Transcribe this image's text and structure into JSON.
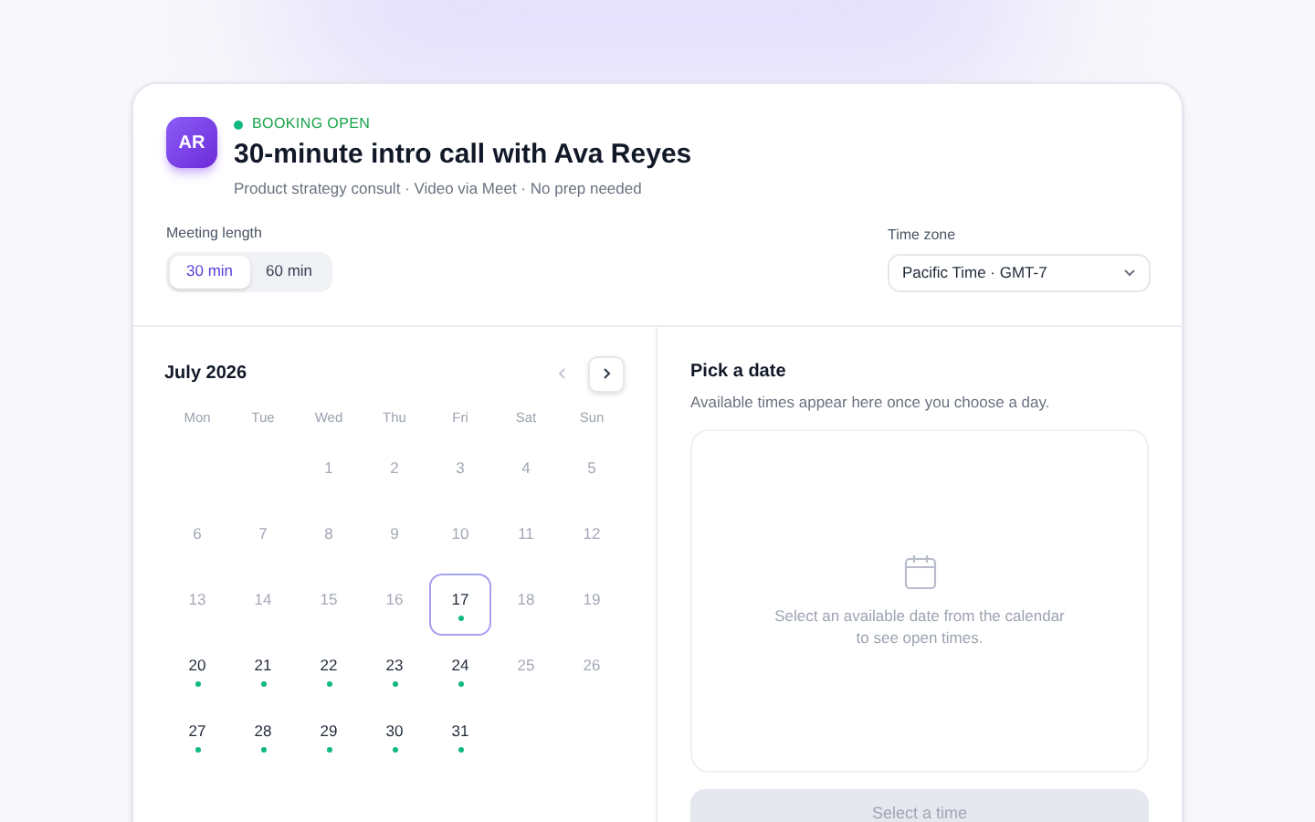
{
  "booking": {
    "status": "BOOKING OPEN",
    "open": true,
    "avatar": "AR",
    "title": "30-minute intro call with Ava Reyes",
    "subtitle": "Product strategy consult · Video via Meet · No prep needed"
  },
  "meeting_length": {
    "label": "Meeting length",
    "options": [
      {
        "label": "30 min",
        "selected": true
      },
      {
        "label": "60 min",
        "selected": false
      }
    ]
  },
  "time_zone": {
    "label": "Time zone",
    "value": "Pacific Time · GMT-7"
  },
  "calendar": {
    "month": "July 2026",
    "prev_disabled": true,
    "next_disabled": false,
    "weekdays": [
      "Mon",
      "Tue",
      "Wed",
      "Thu",
      "Fri",
      "Sat",
      "Sun"
    ],
    "weeks": [
      {
        "kind": "leading",
        "days": [
          {
            "day": "1",
            "available": false,
            "selected": false
          },
          {
            "day": "2",
            "available": false,
            "selected": false
          },
          {
            "day": "3",
            "available": false,
            "selected": false
          },
          {
            "day": "4",
            "available": false,
            "selected": false
          },
          {
            "day": "5",
            "available": false,
            "selected": false
          }
        ]
      },
      {
        "kind": "trailing",
        "days": [
          {
            "day": "6",
            "available": false,
            "selected": false
          },
          {
            "day": "7",
            "available": false,
            "selected": false
          },
          {
            "day": "8",
            "available": false,
            "selected": false
          },
          {
            "day": "9",
            "available": false,
            "selected": false
          },
          {
            "day": "10",
            "available": false,
            "selected": false
          },
          {
            "day": "11",
            "available": false,
            "selected": false
          },
          {
            "day": "12",
            "available": false,
            "selected": false
          }
        ]
      },
      {
        "kind": "trailing",
        "days": [
          {
            "day": "13",
            "available": false,
            "selected": false
          },
          {
            "day": "14",
            "available": false,
            "selected": false
          },
          {
            "day": "15",
            "available": false,
            "selected": false
          },
          {
            "day": "16",
            "available": false,
            "selected": false
          },
          {
            "day": "17",
            "available": true,
            "selected": true
          },
          {
            "day": "18",
            "available": false,
            "selected": false
          },
          {
            "day": "19",
            "available": false,
            "selected": false
          }
        ]
      },
      {
        "kind": "trailing",
        "days": [
          {
            "day": "20",
            "available": true,
            "selected": false
          },
          {
            "day": "21",
            "available": true,
            "selected": false
          },
          {
            "day": "22",
            "available": true,
            "selected": false
          },
          {
            "day": "23",
            "available": true,
            "selected": false
          },
          {
            "day": "24",
            "available": true,
            "selected": false
          },
          {
            "day": "25",
            "available": false,
            "selected": false
          },
          {
            "day": "26",
            "available": false,
            "selected": false
          }
        ]
      },
      {
        "kind": "trailing",
        "days": [
          {
            "day": "27",
            "available": true,
            "selected": false
          },
          {
            "day": "28",
            "available": true,
            "selected": false
          },
          {
            "day": "29",
            "available": true,
            "selected": false
          },
          {
            "day": "30",
            "available": true,
            "selected": false
          },
          {
            "day": "31",
            "available": true,
            "selected": false
          }
        ]
      }
    ]
  },
  "times": {
    "title": "Pick a date",
    "hint": "Available times appear here once you choose a day.",
    "empty_message": "Select an available date from the calendar to see open times.",
    "button": {
      "label": "Select a time",
      "disabled": true
    }
  }
}
